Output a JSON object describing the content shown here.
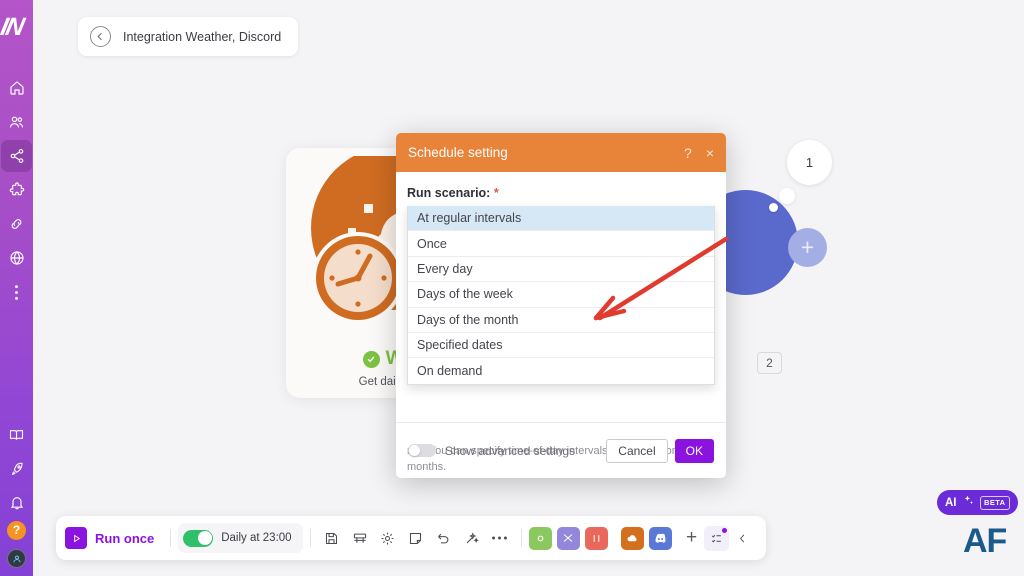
{
  "sidebar": {
    "logo": "IN",
    "items": [
      {
        "name": "home-icon",
        "label": "Home"
      },
      {
        "name": "users-icon",
        "label": "Team"
      },
      {
        "name": "share-nodes-icon",
        "label": "Integrations",
        "active": true
      },
      {
        "name": "puzzle-icon",
        "label": "Apps"
      },
      {
        "name": "link-icon",
        "label": "Connections"
      },
      {
        "name": "globe-icon",
        "label": "Web"
      },
      {
        "name": "ellipsis-icon",
        "label": "More"
      }
    ],
    "bottom_items": [
      {
        "name": "book-icon",
        "label": "Docs"
      },
      {
        "name": "rocket-icon",
        "label": "Upgrade"
      },
      {
        "name": "bell-icon",
        "label": "Notifications"
      }
    ],
    "help_badge": "?",
    "avatar": "avatar-icon"
  },
  "breadcrumb": {
    "back_icon": "arrow-left-circle-icon",
    "text": "Integration Weather, Discord"
  },
  "weather_node": {
    "title": "Wea",
    "subtitle": "Get daily wea",
    "check_icon": "check-circle-icon"
  },
  "flow": {
    "bubble_1": "1",
    "badge_2": "2",
    "plus": "+"
  },
  "modal": {
    "title": "Schedule setting",
    "help_icon": "?",
    "close_icon": "×",
    "field_label": "Run scenario:",
    "required_mark": "*",
    "selected_value": "At regular intervals",
    "caret_icon": "caret-up-icon",
    "options": [
      "At regular intervals",
      "Once",
      "Every day",
      "Days of the week",
      "Days of the month",
      "Specified dates",
      "On demand"
    ],
    "description": "run. You can specify time-of-day intervals, weekdays or months.",
    "advanced_label": "Show advanced settings",
    "cancel_label": "Cancel",
    "ok_label": "OK"
  },
  "toolbar": {
    "run_once_label": "Run once",
    "run_icon": "play-icon",
    "schedule_label": "Daily at 23:00",
    "schedule_enabled": true,
    "icons": [
      {
        "name": "save-icon"
      },
      {
        "name": "layers-icon"
      },
      {
        "name": "gear-icon"
      },
      {
        "name": "note-icon"
      },
      {
        "name": "undo-icon"
      },
      {
        "name": "magic-wand-icon"
      },
      {
        "name": "ellipsis-icon"
      }
    ],
    "apps": [
      {
        "name": "app-tools-icon",
        "color": "#8cc860"
      },
      {
        "name": "app-router-icon",
        "color": "#9287db"
      },
      {
        "name": "app-http-icon",
        "color": "#e8695c"
      },
      {
        "name": "app-weather-icon",
        "color": "#d2701e"
      },
      {
        "name": "app-discord-icon",
        "color": "#5a78d6"
      }
    ],
    "add_label": "+",
    "checklist_icon": "checklist-icon",
    "collapse_icon": "chevron-left-icon"
  },
  "ai_badge": {
    "label": "AI",
    "sparkle_icon": "sparkles-icon",
    "beta": "BETA"
  },
  "brand": {
    "logo_text": "AF"
  },
  "colors": {
    "accent_purple": "#8b13e0",
    "header_orange": "#e8833a",
    "toggle_green": "#2fc06a",
    "arrow_red": "#e03b2f",
    "discord_blue": "#5a69cc"
  }
}
